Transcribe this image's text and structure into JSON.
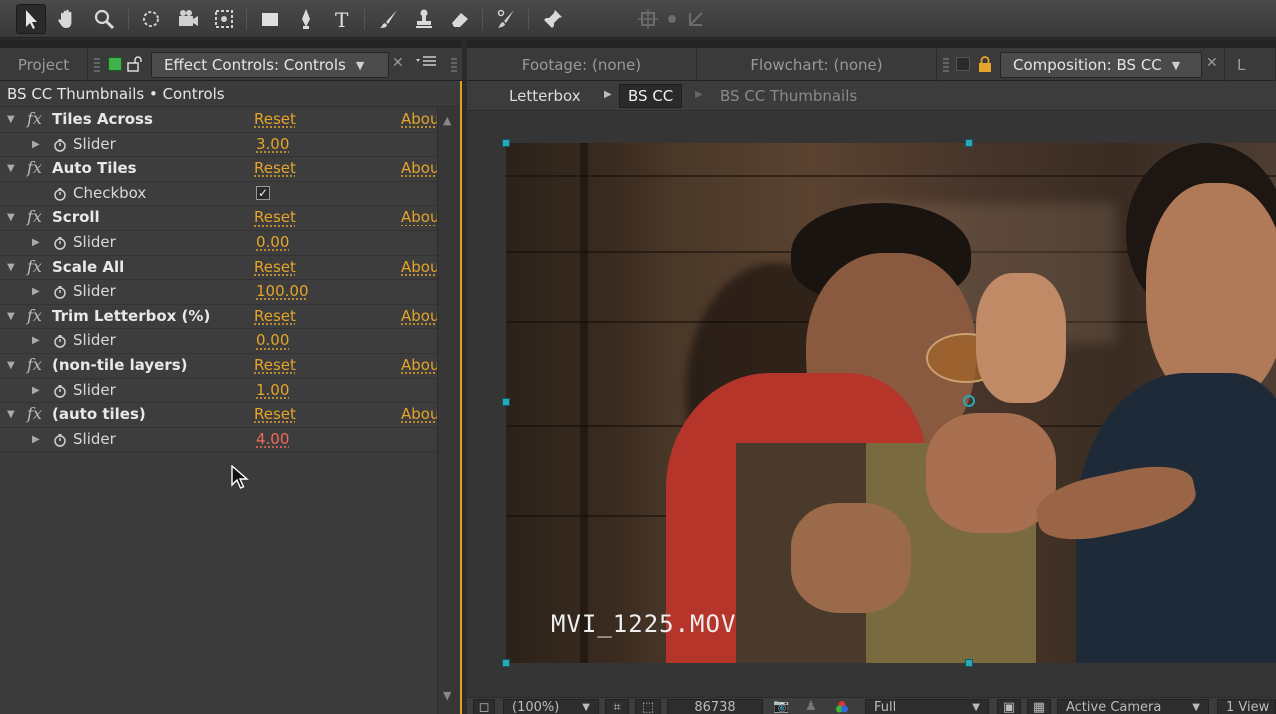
{
  "toolbar": {
    "tools": [
      "selection-tool",
      "hand-tool",
      "zoom-tool",
      "rotation-tool",
      "camera-tool",
      "pan-behind-tool",
      "rectangle-tool",
      "pen-tool",
      "type-tool",
      "brush-tool",
      "clone-stamp-tool",
      "eraser-tool",
      "roto-brush-tool",
      "puppet-pin-tool"
    ]
  },
  "left_tabs": {
    "project": "Project",
    "effect_controls": "Effect Controls: Controls"
  },
  "right_tabs": {
    "footage": "Footage: (none)",
    "flowchart": "Flowchart: (none)",
    "composition": "Composition: BS CC",
    "overflow": "L"
  },
  "effects_panel": {
    "title": "BS CC Thumbnails • Controls",
    "reset_label": "Reset",
    "about_label": "Abou",
    "effects": [
      {
        "name": "Tiles Across",
        "param": "Slider",
        "value": "3.00",
        "value_color": "orange"
      },
      {
        "name": "Auto Tiles",
        "param": "Checkbox",
        "checkbox": "✓"
      },
      {
        "name": "Scroll",
        "param": "Slider",
        "value": "0.00",
        "value_color": "orange"
      },
      {
        "name": "Scale All",
        "param": "Slider",
        "value": "100.00",
        "value_color": "orange"
      },
      {
        "name": "Trim Letterbox (%)",
        "param": "Slider",
        "value": "0.00",
        "value_color": "orange"
      },
      {
        "name": "(non-tile layers)",
        "param": "Slider",
        "value": "1.00",
        "value_color": "orange"
      },
      {
        "name": "(auto tiles)",
        "param": "Slider",
        "value": "4.00",
        "value_color": "red"
      }
    ]
  },
  "composition": {
    "breadcrumbs": [
      "Letterbox",
      "BS CC",
      "BS CC Thumbnails"
    ],
    "clip_name": "MVI_1225.MOV"
  },
  "viewer_bar": {
    "zoom": "(100%)",
    "timecode": "86738",
    "resolution": "Full",
    "camera": "Active Camera",
    "views": "1 View"
  }
}
